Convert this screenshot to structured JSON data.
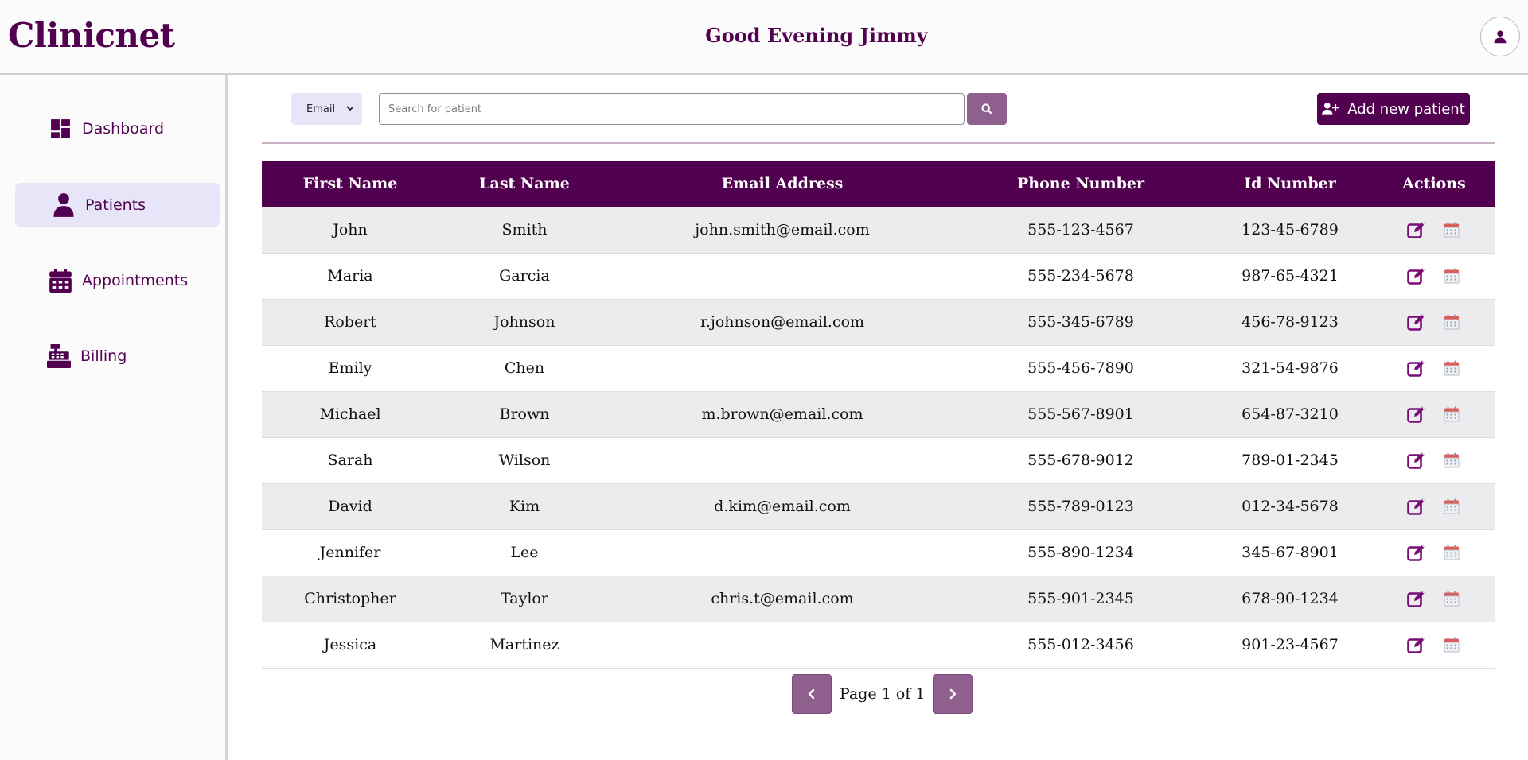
{
  "app": {
    "brand": "Clinicnet",
    "greeting": "Good Evening Jimmy",
    "profile_icon": "user-icon"
  },
  "sidebar": {
    "items": [
      {
        "label": "Dashboard",
        "icon": "dashboard-icon",
        "active": false
      },
      {
        "label": "Patients",
        "icon": "user-icon",
        "active": true
      },
      {
        "label": "Appointments",
        "icon": "calendar-icon",
        "active": false
      },
      {
        "label": "Billing",
        "icon": "cash-register-icon",
        "active": false
      }
    ]
  },
  "toolbar": {
    "filter_value": "Email",
    "search_placeholder": "Search for patient",
    "search_icon": "search-icon",
    "add_label": "Add new patient",
    "add_icon": "user-plus-icon"
  },
  "table": {
    "columns": [
      "First Name",
      "Last Name",
      "Email Address",
      "Phone Number",
      "Id Number",
      "Actions"
    ],
    "rows": [
      {
        "first": "John",
        "last": "Smith",
        "email": "john.smith@email.com",
        "phone": "555-123-4567",
        "id": "123-45-6789"
      },
      {
        "first": "Maria",
        "last": "Garcia",
        "email": "",
        "phone": "555-234-5678",
        "id": "987-65-4321"
      },
      {
        "first": "Robert",
        "last": "Johnson",
        "email": "r.johnson@email.com",
        "phone": "555-345-6789",
        "id": "456-78-9123"
      },
      {
        "first": "Emily",
        "last": "Chen",
        "email": "",
        "phone": "555-456-7890",
        "id": "321-54-9876"
      },
      {
        "first": "Michael",
        "last": "Brown",
        "email": "m.brown@email.com",
        "phone": "555-567-8901",
        "id": "654-87-3210"
      },
      {
        "first": "Sarah",
        "last": "Wilson",
        "email": "",
        "phone": "555-678-9012",
        "id": "789-01-2345"
      },
      {
        "first": "David",
        "last": "Kim",
        "email": "d.kim@email.com",
        "phone": "555-789-0123",
        "id": "012-34-5678"
      },
      {
        "first": "Jennifer",
        "last": "Lee",
        "email": "",
        "phone": "555-890-1234",
        "id": "345-67-8901"
      },
      {
        "first": "Christopher",
        "last": "Taylor",
        "email": "chris.t@email.com",
        "phone": "555-901-2345",
        "id": "678-90-1234"
      },
      {
        "first": "Jessica",
        "last": "Martinez",
        "email": "",
        "phone": "555-012-3456",
        "id": "901-23-4567"
      }
    ],
    "row_actions": [
      "edit-icon",
      "calendar-icon"
    ]
  },
  "pagination": {
    "text": "Page 1 of 1",
    "prev_icon": "chevron-left-icon",
    "next_icon": "chevron-right-icon"
  },
  "colors": {
    "brand": "#520150",
    "accent_muted": "#8f5f8e",
    "active_nav_bg": "#e6e6f8",
    "calendar_icon": "#e05a5a"
  }
}
